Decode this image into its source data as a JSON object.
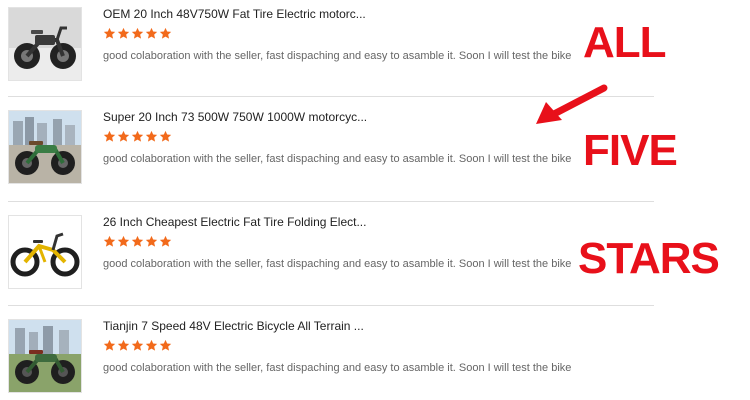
{
  "reviews": [
    {
      "title": "OEM 20 Inch 48V750W Fat Tire Electric motorc...",
      "rating": 5,
      "comment": "good colaboration with the seller, fast dispaching and easy to asamble it. Soon I will test the bike",
      "thumbnail_icon": "fat-tire-motorcycle-ebike-thumbnail"
    },
    {
      "title": "Super 20 Inch 73 500W 750W 1000W motorcyc...",
      "rating": 5,
      "comment": "good colaboration with the seller, fast dispaching and easy to asamble it. Soon I will test the bike",
      "thumbnail_icon": "green-retro-ebike-thumbnail"
    },
    {
      "title": "26 Inch Cheapest Electric Fat Tire Folding Elect...",
      "rating": 5,
      "comment": "good colaboration with the seller, fast dispaching and easy to asamble it. Soon I will test the bike",
      "thumbnail_icon": "yellow-folding-ebike-thumbnail"
    },
    {
      "title": "Tianjin 7 Speed 48V Electric Bicycle All Terrain ...",
      "rating": 5,
      "comment": "good colaboration with the seller, fast dispaching and easy to asamble it. Soon I will test the bike",
      "thumbnail_icon": "green-all-terrain-ebike-thumbnail"
    }
  ],
  "annotation": {
    "line1": "ALL",
    "line2": "FIVE",
    "line3": "STARS",
    "color": "#e8101a"
  },
  "colors": {
    "star": "#f26a1b",
    "divider": "#dedede",
    "title": "#222222",
    "comment": "#666666"
  }
}
